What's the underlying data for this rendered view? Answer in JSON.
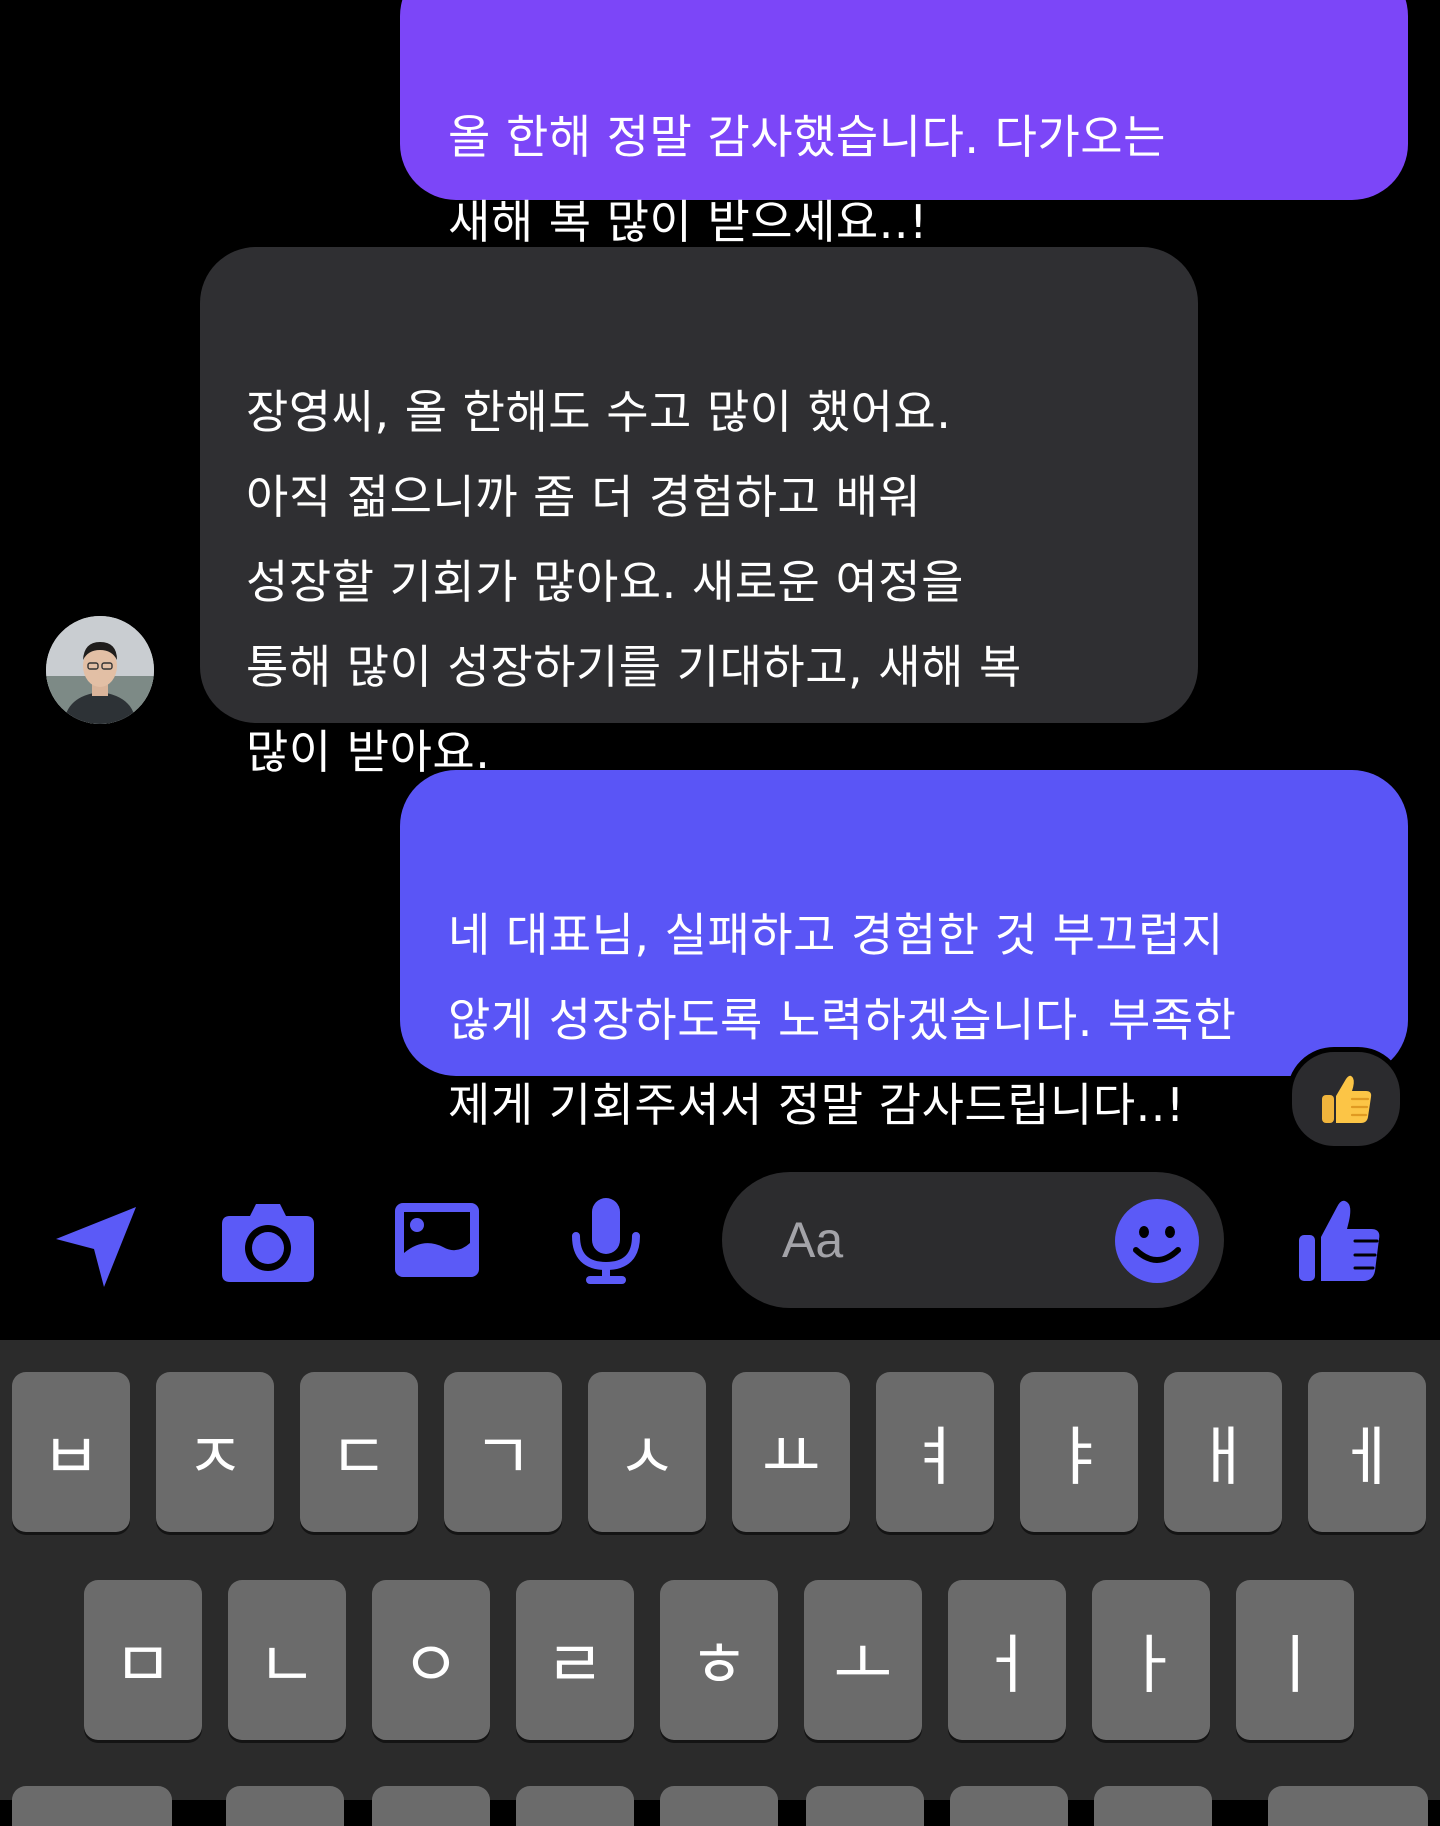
{
  "messages": [
    {
      "id": "sent-1",
      "direction": "sent",
      "text": "올 한해 정말 감사했습니다. 다가오는\n새해 복 많이 받으세요..!"
    },
    {
      "id": "recv-1",
      "direction": "received",
      "text": "장영씨, 올 한해도 수고 많이 했어요.\n아직 젊으니까 좀 더 경험하고 배워\n성장할 기회가 많아요. 새로운 여정을\n통해 많이 성장하기를 기대하고, 새해 복\n많이 받아요."
    },
    {
      "id": "sent-2",
      "direction": "sent",
      "text": "네 대표님, 실패하고 경험한 것 부끄럽지\n않게 성장하도록 노력하겠습니다. 부족한\n제게 기회주셔서 정말 감사드립니다..!",
      "reaction": "👍"
    }
  ],
  "composer": {
    "placeholder": "Aa",
    "icons": [
      "send-location-icon",
      "camera-icon",
      "gallery-icon",
      "microphone-icon",
      "emoji-icon",
      "thumbs-up-icon"
    ]
  },
  "keyboard": {
    "row1": [
      "ㅂ",
      "ㅈ",
      "ㄷ",
      "ㄱ",
      "ㅅ",
      "ㅛ",
      "ㅕ",
      "ㅑ",
      "ㅐ",
      "ㅔ"
    ],
    "row2": [
      "ㅁ",
      "ㄴ",
      "ㅇ",
      "ㄹ",
      "ㅎ",
      "ㅗ",
      "ㅓ",
      "ㅏ",
      "ㅣ"
    ]
  },
  "colors": {
    "sent_top": "#7f45f8",
    "sent_bottom": "#5c55f6",
    "received": "#2f2f32",
    "accent": "#5b5af7",
    "background": "#000000",
    "keyboard_bg": "#2b2b2b",
    "key_bg": "#6b6b6b"
  }
}
